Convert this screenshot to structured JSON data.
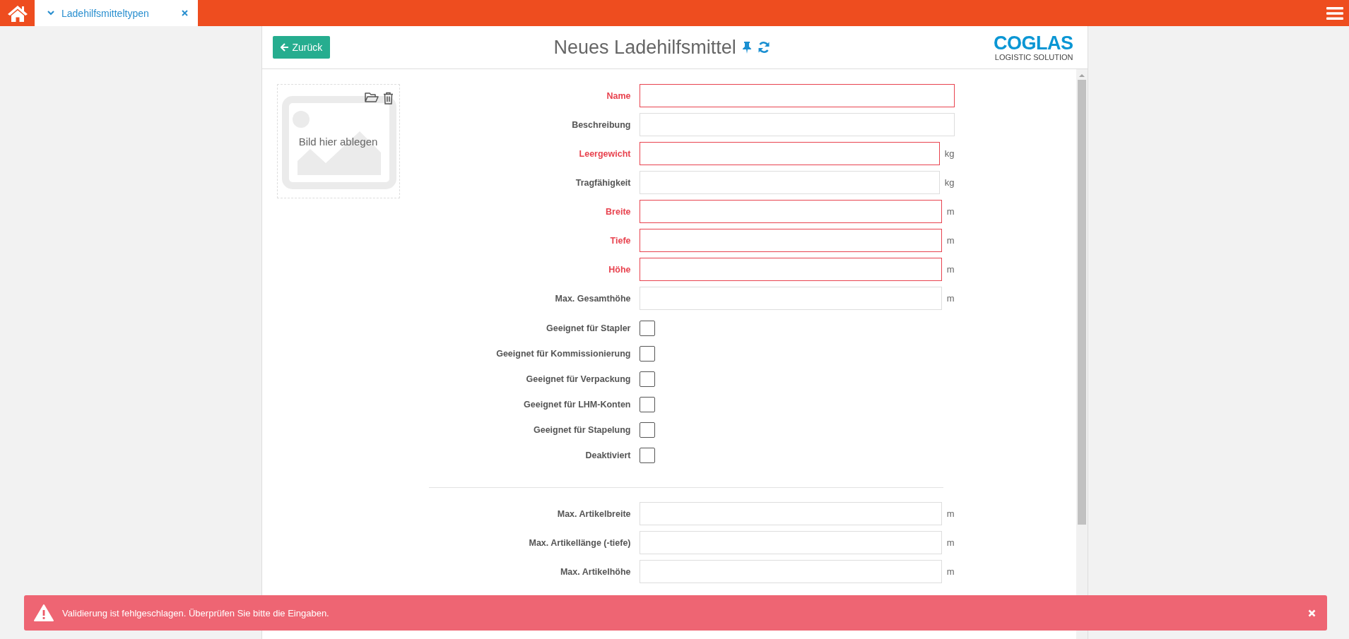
{
  "tabs": [
    {
      "label": "Ladehilfsmitteltypen",
      "selected": true
    }
  ],
  "header": {
    "back_button": "Zurück",
    "title": "Neues Ladehilfsmittel",
    "logo": {
      "name": "COGLAS",
      "tagline": "LOGISTIC SOLUTION"
    }
  },
  "image_drop": {
    "hint": "Bild hier ablegen"
  },
  "fields": [
    {
      "label": "Name",
      "invalid": true
    },
    {
      "label": "Beschreibung",
      "invalid": false
    },
    {
      "label": "Leergewicht",
      "unit": "kg",
      "invalid": true
    },
    {
      "label": "Tragfähigkeit",
      "unit": "kg",
      "invalid": false
    },
    {
      "label": "Breite",
      "unit": "m",
      "invalid": true
    },
    {
      "label": "Tiefe",
      "unit": "m",
      "invalid": true
    },
    {
      "label": "Höhe",
      "unit": "m",
      "invalid": true
    },
    {
      "label": "Max. Gesamthöhe",
      "unit": "m",
      "invalid": false
    }
  ],
  "checkboxes": [
    {
      "label": "Geeignet für Stapler",
      "checked": false
    },
    {
      "label": "Geeignet für Kommissionierung",
      "checked": false
    },
    {
      "label": "Geeignet für Verpackung",
      "checked": false
    },
    {
      "label": "Geeignet für LHM-Konten",
      "checked": false
    },
    {
      "label": "Geeignet für Stapelung",
      "checked": false
    },
    {
      "label": "Deaktiviert",
      "checked": false
    }
  ],
  "article_fields": [
    {
      "label": "Max. Artikelbreite",
      "unit": "m",
      "invalid": false
    },
    {
      "label": "Max. Artikellänge (-tiefe)",
      "unit": "m",
      "invalid": false
    },
    {
      "label": "Max. Artikelhöhe",
      "unit": "m",
      "invalid": false
    }
  ],
  "toast": {
    "message": "Validierung ist fehlgeschlagen. Überprüfen Sie bitte die Eingaben."
  }
}
